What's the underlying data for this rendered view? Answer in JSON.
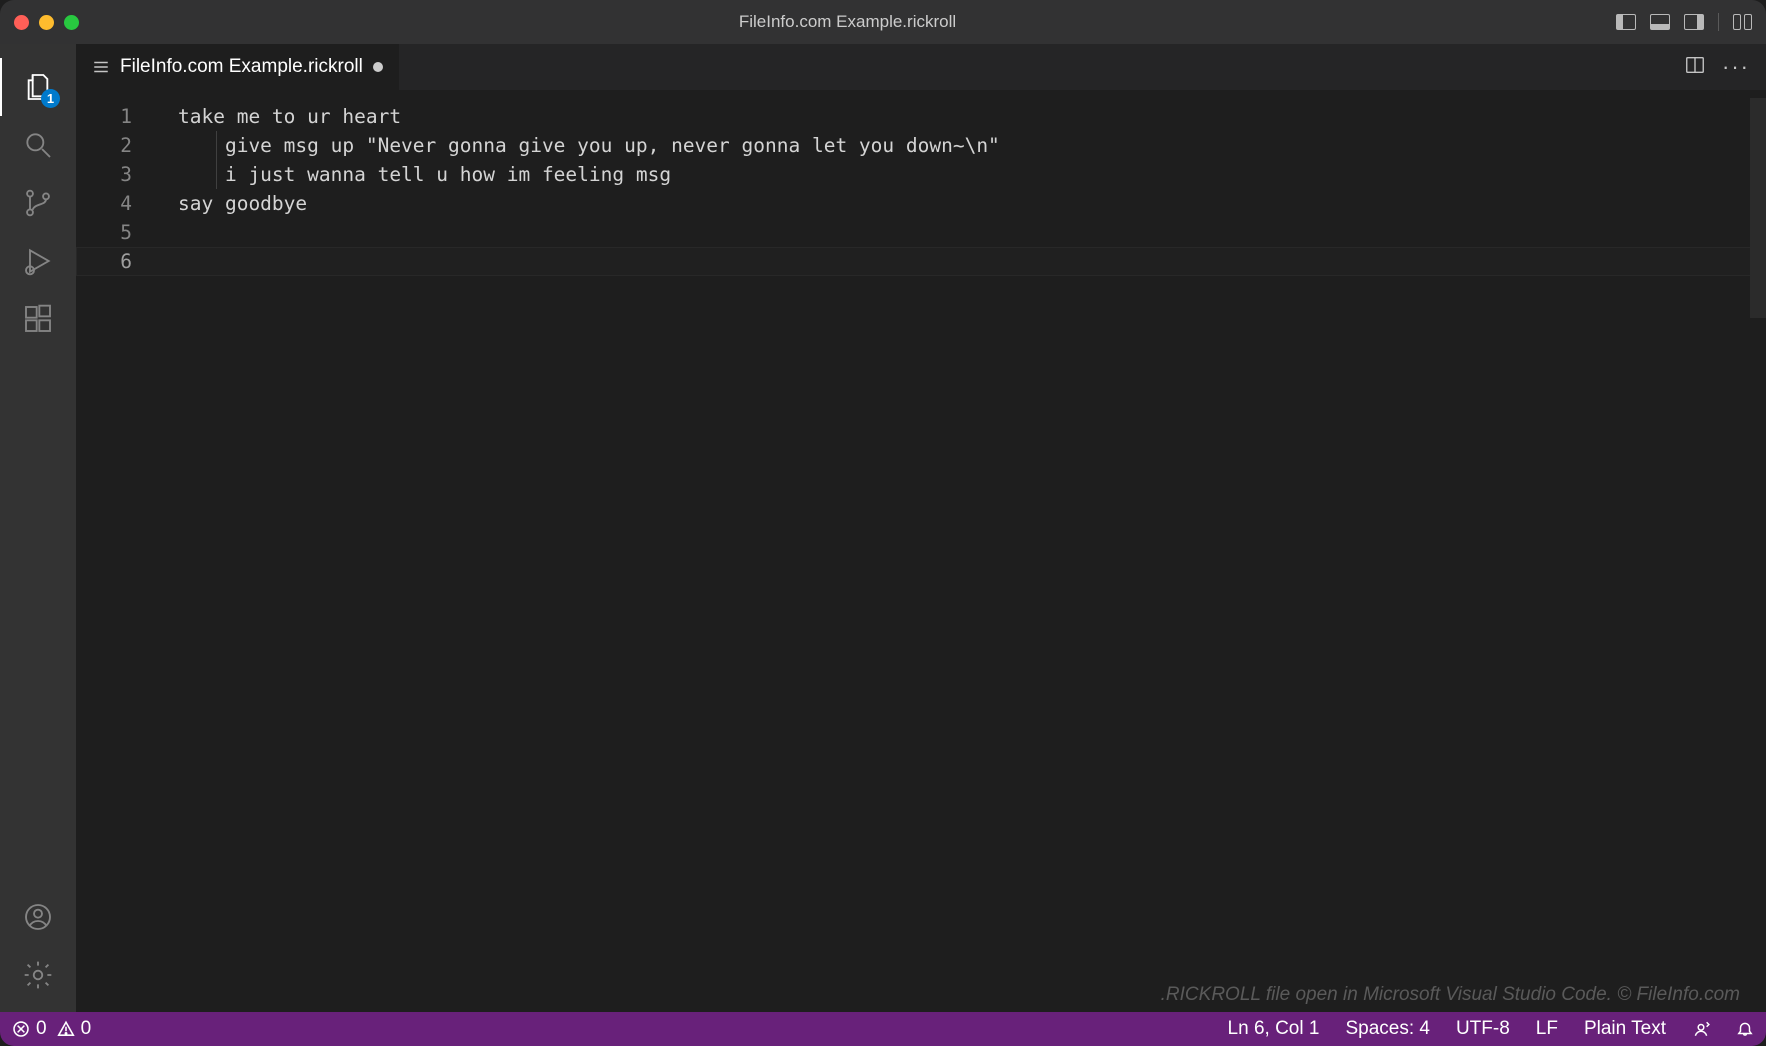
{
  "titlebar": {
    "title": "FileInfo.com Example.rickroll"
  },
  "activitybar": {
    "explorer_badge": "1"
  },
  "tabs": {
    "active": {
      "label": "FileInfo.com Example.rickroll",
      "modified": true
    }
  },
  "editor": {
    "line_numbers": [
      "1",
      "2",
      "3",
      "4",
      "5",
      "6"
    ],
    "current_line_index": 5,
    "lines": [
      "take me to ur heart",
      "    give msg up \"Never gonna give you up, never gonna let you down~\\n\"",
      "    i just wanna tell u how im feeling msg",
      "say goodbye",
      "",
      ""
    ]
  },
  "watermark": ".RICKROLL file open in Microsoft Visual Studio Code. © FileInfo.com",
  "statusbar": {
    "errors": "0",
    "warnings": "0",
    "position": "Ln 6, Col 1",
    "indent": "Spaces: 4",
    "encoding": "UTF-8",
    "eol": "LF",
    "language": "Plain Text"
  }
}
